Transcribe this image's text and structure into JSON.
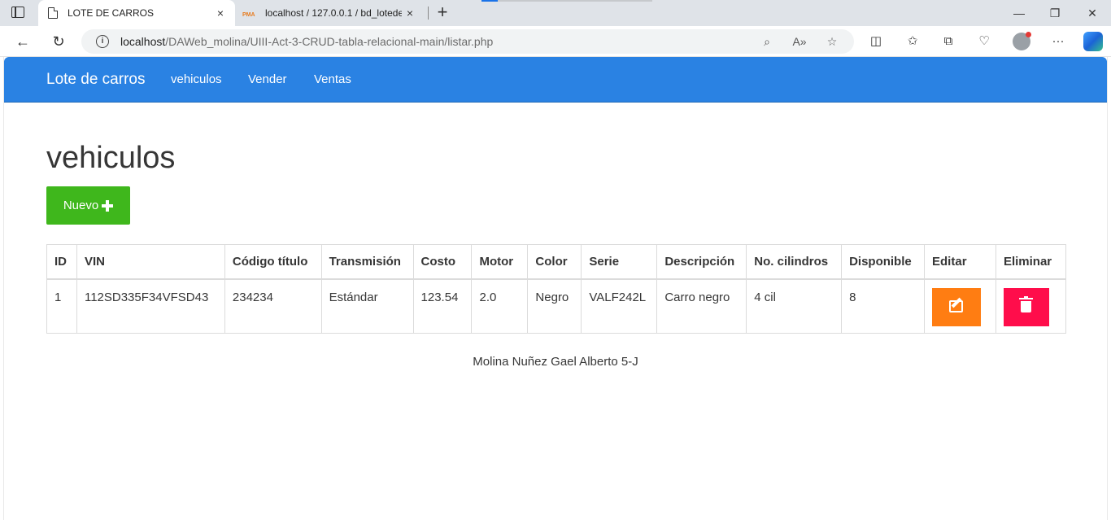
{
  "browser": {
    "tabs": [
      {
        "title": "LOTE DE CARROS",
        "active": true
      },
      {
        "title": "localhost / 127.0.0.1 / bd_lotedec",
        "active": false
      }
    ],
    "url_host": "localhost",
    "url_path": "/DAWeb_molina/UIII-Act-3-CRUD-tabla-relacional-main/listar.php",
    "icons": {
      "close": "×",
      "new_tab": "+",
      "minimize": "—",
      "restore": "❐",
      "window_close": "✕",
      "back": "←",
      "refresh": "↻",
      "zoom": "⌕",
      "read_aloud": "A»",
      "favorite": "☆",
      "split": "◫",
      "favorites": "✩",
      "collections": "⧉",
      "health": "♡",
      "more": "···"
    }
  },
  "navbar": {
    "brand": "Lote de carros",
    "links": [
      "vehiculos",
      "Vender",
      "Ventas"
    ],
    "color": "#2a82e3"
  },
  "page": {
    "title": "vehiculos",
    "new_button": "Nuevo"
  },
  "table": {
    "headers": [
      "ID",
      "VIN",
      "Código título",
      "Transmisión",
      "Costo",
      "Motor",
      "Color",
      "Serie",
      "Descripción",
      "No. cilindros",
      "Disponible",
      "Editar",
      "Eliminar"
    ],
    "rows": [
      {
        "id": "1",
        "vin": "112SD335F34VFSD43",
        "codigo_titulo": "234234",
        "transmision": "Estándar",
        "costo": "123.54",
        "motor": "2.0",
        "color": "Negro",
        "serie": "VALF242L",
        "descripcion": "Carro negro",
        "cilindros": "4 cil",
        "disponible": "8"
      }
    ],
    "edit_color": "#ff7d12",
    "delete_color": "#ff0d4b"
  },
  "footer": {
    "text": "Molina Nuñez Gael Alberto 5-J"
  }
}
